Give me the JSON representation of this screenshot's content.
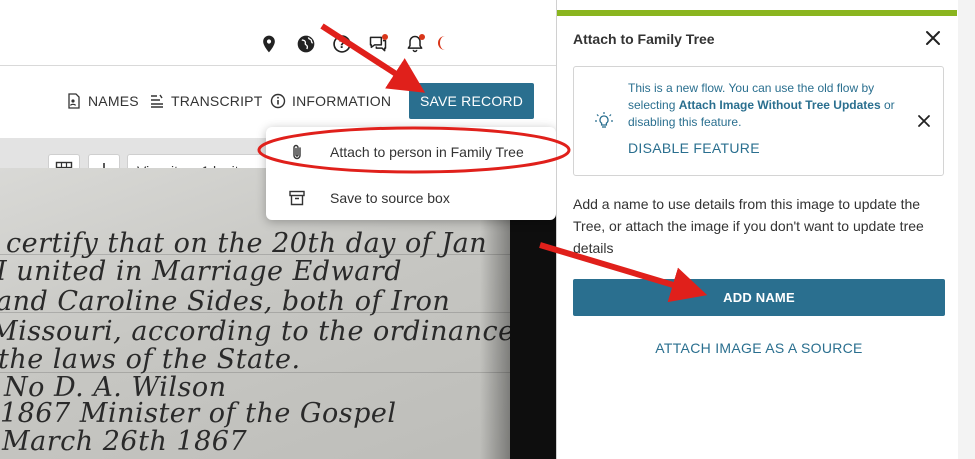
{
  "header": {
    "icons": [
      "location-icon",
      "globe-icon",
      "help-icon",
      "chat-icon",
      "bell-icon"
    ]
  },
  "toolbar": {
    "names_label": "NAMES",
    "transcript_label": "TRANSCRIPT",
    "information_label": "INFORMATION",
    "save_record_label": "SAVE RECORD"
  },
  "viewer": {
    "view_item_label": "View item 1 by itse"
  },
  "menu": {
    "attach_label": "Attach to person in Family Tree",
    "save_source_label": "Save to source box"
  },
  "document": {
    "lines": [
      "certify that on the 20th day of Jan",
      "I united in Marriage Edward",
      "and Caroline Sides, both of Iron",
      "Missouri, according to the ordinance",
      "the laws of the State.",
      "No     D. A. Wilson",
      "1867   Minister of the Gospel",
      "March 26th 1867"
    ]
  },
  "panel": {
    "title": "Attach to Family Tree",
    "info": {
      "text_1": "This is a new flow. You can use the old flow by selecting ",
      "bold": "Attach Image Without Tree Updates",
      "text_2": " or disabling this feature.",
      "disable_label": "DISABLE FEATURE"
    },
    "description": "Add a name to use details from this image to update the Tree, or attach the image if you don't want to update tree details",
    "add_name_label": "ADD NAME",
    "attach_source_label": "ATTACH IMAGE AS A SOURCE"
  },
  "colors": {
    "primary": "#2a6f8f",
    "accent_bar": "#8ab51f",
    "annotation": "#e0201b",
    "notification": "#d9361a"
  }
}
